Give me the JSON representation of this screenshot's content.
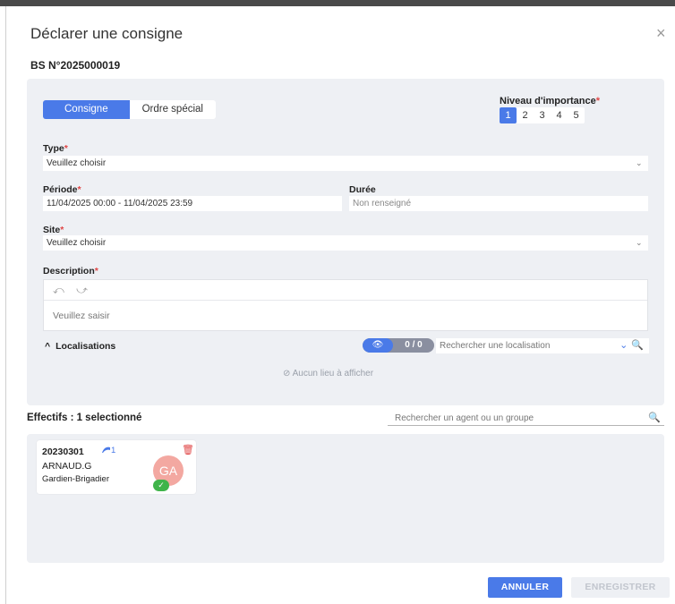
{
  "dialog": {
    "title": "Déclarer une consigne",
    "close_icon": "×",
    "bs_number": "BS N°2025000019"
  },
  "segment": {
    "options": [
      "Consigne",
      "Ordre spécial"
    ],
    "selected": "Consigne"
  },
  "importance": {
    "label": "Niveau d'importance",
    "required_mark": "*",
    "levels": [
      "1",
      "2",
      "3",
      "4",
      "5"
    ],
    "selected": "1"
  },
  "type": {
    "label": "Type",
    "required_mark": "*",
    "value": "Veuillez choisir"
  },
  "periode": {
    "label": "Période",
    "required_mark": "*",
    "value": "11/04/2025 00:00 - 11/04/2025 23:59"
  },
  "duree": {
    "label": "Durée",
    "value": "Non renseigné"
  },
  "site": {
    "label": "Site",
    "required_mark": "*",
    "value": "Veuillez choisir"
  },
  "description": {
    "label": "Description",
    "required_mark": "*",
    "undo_icon": "⤺",
    "redo_icon": "⤻",
    "placeholder": "Veuillez saisir"
  },
  "localisations": {
    "label": "Localisations",
    "toggle_icon": "^",
    "eye_icon": "👁",
    "count": "0 / 0",
    "search_placeholder": "Rechercher une localisation",
    "chevron_icon": "⌄",
    "search_icon": "🔍",
    "empty_icon": "⊘",
    "empty_text": "Aucun lieu à afficher"
  },
  "effectifs": {
    "title": "Effectifs : 1 selectionné",
    "search_placeholder": "Rechercher un agent ou un groupe",
    "search_icon": "🔍",
    "agents": [
      {
        "matricule": "20230301",
        "badge": "1",
        "name": "ARNAUD.G",
        "grade": "Gardien-Brigadier",
        "initials": "GA",
        "trash_icon": "🗑",
        "check_icon": "✓"
      }
    ]
  },
  "footer": {
    "cancel_label": "ANNULER",
    "save_label": "ENREGISTRER"
  },
  "colors": {
    "accent": "#4a7ae8",
    "required": "#e04646",
    "panel": "#eef0f4",
    "avatar": "#f3a8a1",
    "check": "#3fb44a"
  }
}
